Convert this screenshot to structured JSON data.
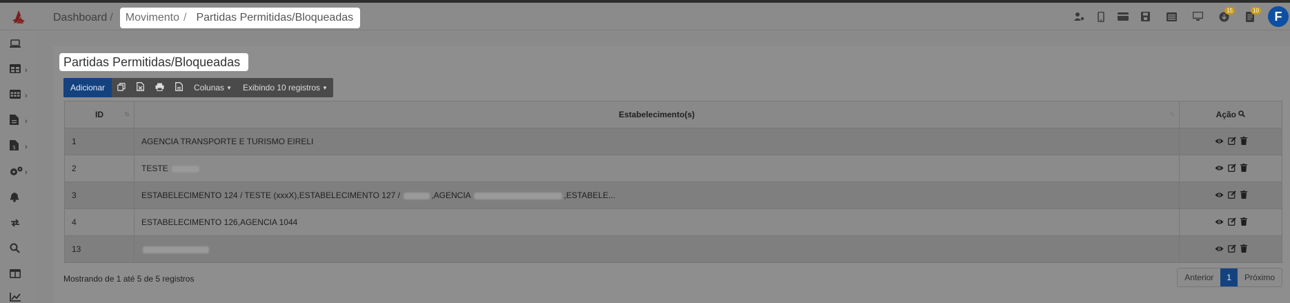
{
  "breadcrumb": {
    "items": [
      "Dashboard",
      "Movimento",
      "Partidas Permitidas/Bloqueadas"
    ],
    "separator": "/"
  },
  "page": {
    "title": "Partidas Permitidas/Bloqueadas"
  },
  "topbar": {
    "user_initial": "F",
    "badges": {
      "download": "15",
      "document": "10"
    },
    "icons": [
      "user-settings-icon",
      "mobile-icon",
      "card-icon",
      "save-icon",
      "list-icon",
      "monitor-icon",
      "download-icon",
      "document-icon"
    ]
  },
  "sidebar": {
    "icons": [
      "laptop-icon",
      "table-icon",
      "grid-icon",
      "file-icon",
      "invoice-icon",
      "cogs-icon",
      "bell-icon",
      "sync-icon",
      "search-icon",
      "columns-icon",
      "chart-icon"
    ]
  },
  "toolbar": {
    "add_label": "Adicionar",
    "columns_label": "Colunas",
    "showing_label": "Exibindo 10 registros"
  },
  "table": {
    "headers": {
      "id": "ID",
      "establishments": "Estabelecimento(s)",
      "action": "Ação"
    },
    "rows": [
      {
        "id": "1",
        "establishments": "AGENCIA TRANSPORTE E TURISMO EIRELI"
      },
      {
        "id": "2",
        "establishments": "TESTE"
      },
      {
        "id": "3",
        "establishments_parts": [
          "ESTABELECIMENTO 124 / TESTE (xxxX),ESTABELECIMENTO 127 /",
          ",AGENCIA",
          ",ESTABELE..."
        ]
      },
      {
        "id": "4",
        "establishments": "ESTABELECIMENTO 126,AGENCIA 1044"
      },
      {
        "id": "13",
        "establishments": ""
      }
    ]
  },
  "footer": {
    "info": "Mostrando de 1 até 5 de 5 registros",
    "prev_label": "Anterior",
    "page_label": "1",
    "next_label": "Próximo"
  },
  "colors": {
    "primary": "#14427f",
    "avatar": "#0d4fa3",
    "badge": "#c89a18"
  }
}
